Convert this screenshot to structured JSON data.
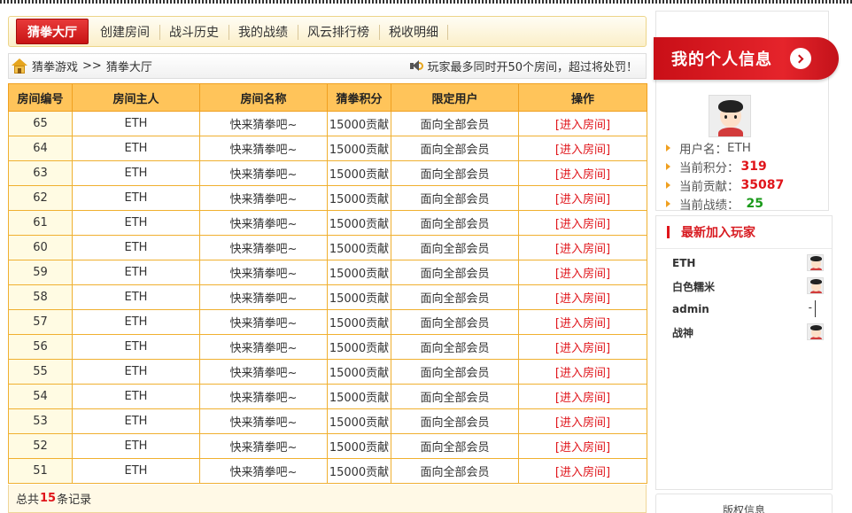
{
  "nav": {
    "items": [
      "猜拳大厅",
      "创建房间",
      "战斗历史",
      "我的战绩",
      "风云排行榜",
      "税收明细"
    ],
    "active_index": 0
  },
  "breadcrumb": {
    "home_icon": "home-icon",
    "root": "猜拳游戏",
    "separator": ">>",
    "current": "猜拳大厅"
  },
  "notice": {
    "icon": "speaker-icon",
    "text": "玩家最多同时开50个房间，超过将处罚！"
  },
  "table": {
    "headers": [
      "房间编号",
      "房间主人",
      "房间名称",
      "猜拳积分",
      "限定用户",
      "操作"
    ],
    "rows": [
      [
        "65",
        "ETH",
        "快来猜拳吧~",
        "15000贡献",
        "面向全部会员",
        "[进入房间]"
      ],
      [
        "64",
        "ETH",
        "快来猜拳吧~",
        "15000贡献",
        "面向全部会员",
        "[进入房间]"
      ],
      [
        "63",
        "ETH",
        "快来猜拳吧~",
        "15000贡献",
        "面向全部会员",
        "[进入房间]"
      ],
      [
        "62",
        "ETH",
        "快来猜拳吧~",
        "15000贡献",
        "面向全部会员",
        "[进入房间]"
      ],
      [
        "61",
        "ETH",
        "快来猜拳吧~",
        "15000贡献",
        "面向全部会员",
        "[进入房间]"
      ],
      [
        "60",
        "ETH",
        "快来猜拳吧~",
        "15000贡献",
        "面向全部会员",
        "[进入房间]"
      ],
      [
        "59",
        "ETH",
        "快来猜拳吧~",
        "15000贡献",
        "面向全部会员",
        "[进入房间]"
      ],
      [
        "58",
        "ETH",
        "快来猜拳吧~",
        "15000贡献",
        "面向全部会员",
        "[进入房间]"
      ],
      [
        "57",
        "ETH",
        "快来猜拳吧~",
        "15000贡献",
        "面向全部会员",
        "[进入房间]"
      ],
      [
        "56",
        "ETH",
        "快来猜拳吧~",
        "15000贡献",
        "面向全部会员",
        "[进入房间]"
      ],
      [
        "55",
        "ETH",
        "快来猜拳吧~",
        "15000贡献",
        "面向全部会员",
        "[进入房间]"
      ],
      [
        "54",
        "ETH",
        "快来猜拳吧~",
        "15000贡献",
        "面向全部会员",
        "[进入房间]"
      ],
      [
        "53",
        "ETH",
        "快来猜拳吧~",
        "15000贡献",
        "面向全部会员",
        "[进入房间]"
      ],
      [
        "52",
        "ETH",
        "快来猜拳吧~",
        "15000贡献",
        "面向全部会员",
        "[进入房间]"
      ],
      [
        "51",
        "ETH",
        "快来猜拳吧~",
        "15000贡献",
        "面向全部会员",
        "[进入房间]"
      ]
    ]
  },
  "footer": {
    "prefix": "总共",
    "count": "15",
    "suffix": "条记录"
  },
  "profile": {
    "title": "我的个人信息",
    "username_label": "用户名：",
    "username": "ETH",
    "score_label": "当前积分：",
    "score": "319",
    "contribution_label": "当前贡献：",
    "contribution": "35087",
    "record_label": "当前战绩：",
    "record": "25"
  },
  "players": {
    "title": "最新加入玩家",
    "list": [
      {
        "name": "ETH",
        "has_avatar": true
      },
      {
        "name": "白色糯米",
        "has_avatar": true
      },
      {
        "name": "admin",
        "has_avatar": false,
        "mark": "-"
      },
      {
        "name": "战神",
        "has_avatar": true
      }
    ]
  },
  "copyright": {
    "label": "版权信息"
  },
  "colors": {
    "accent_red": "#e0151b",
    "header_orange": "#ffc45a",
    "green": "#1a9a1a"
  }
}
